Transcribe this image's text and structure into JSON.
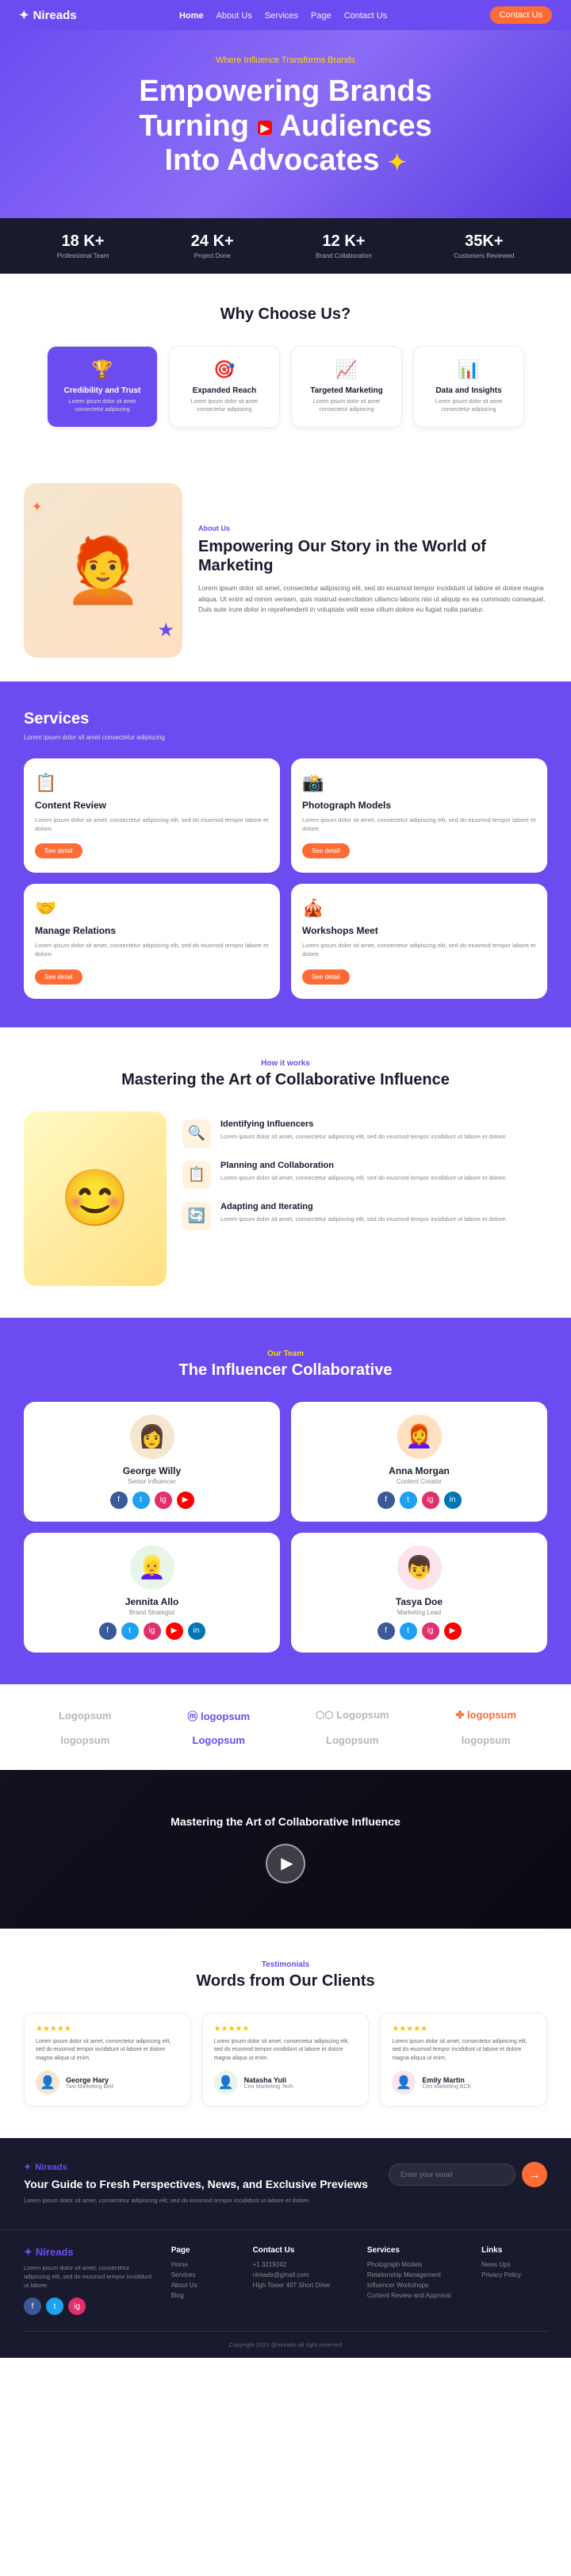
{
  "nav": {
    "logo": "Nireads",
    "links": [
      "Home",
      "About Us",
      "Services",
      "Page",
      "Contact Us"
    ],
    "active_link": "Home",
    "contact_btn": "Contact Us"
  },
  "hero": {
    "tagline": "Where Influence Transforms Brands",
    "headline_line1": "Empowering Brands",
    "headline_line2": "Turning",
    "headline_line3": "Audiences",
    "headline_line4": "Into Advocates",
    "youtube_icon": "▶",
    "star_icon": "✦"
  },
  "stats": [
    {
      "number": "18 K+",
      "label": "Professional Team"
    },
    {
      "number": "24 K+",
      "label": "Project Done"
    },
    {
      "number": "12 K+",
      "label": "Brand Collaboration"
    },
    {
      "number": "35K+",
      "label": "Customers Reviewed"
    }
  ],
  "why_choose": {
    "title": "Why Choose Us?",
    "cards": [
      {
        "icon": "🏆",
        "title": "Credibility and Trust",
        "text": "Lorem ipsum dolor sit amet consectetur adipiscing",
        "active": true
      },
      {
        "icon": "🎯",
        "title": "Expanded Reach",
        "text": "Lorem ipsum dolor sit amet consectetur adipiscing",
        "active": false
      },
      {
        "icon": "📈",
        "title": "Targeted Marketing",
        "text": "Lorem ipsum dolor sit amet consectetur adipiscing",
        "active": false
      },
      {
        "icon": "📊",
        "title": "Data and Insights",
        "text": "Lorem ipsum dolor sit amet consectetur adipiscing",
        "active": false
      }
    ]
  },
  "about": {
    "sub_label": "About Us",
    "title": "Empowering Our Story in the World of Marketing",
    "text": "Lorem ipsum dolor sit amet, consectetur adipiscing elit, sed do eiusmod tempor incididunt ut labore et dolore magna aliqua. Ut enim ad minim veniam, quis nostrud exercitation ullamco laboris nisi ut aliquip ex ea commodo consequat. Duis aute irure dolor in reprehenderit in voluptate velit esse cillum dolore eu fugiat nulla pariatur."
  },
  "services": {
    "title": "Services",
    "description": "Lorem ipsum dolor sit amet consectetur adipiscing",
    "cards": [
      {
        "icon": "📋",
        "title": "Content Review",
        "text": "Lorem ipsum dolor sit amet, consectetur adipiscing elit, sed do eiusmod tempor labore et dolore.",
        "btn": "See detail"
      },
      {
        "icon": "📸",
        "title": "Photograph Models",
        "text": "Lorem ipsum dolor sit amet, consectetur adipiscing elit, sed do eiusmod tempor labore et dolore.",
        "btn": "See detail"
      },
      {
        "icon": "🤝",
        "title": "Manage Relations",
        "text": "Lorem ipsum dolor sit amet, consectetur adipiscing elit, sed do eiusmod tempor labore et dolore.",
        "btn": "See detail"
      },
      {
        "icon": "🎪",
        "title": "Workshops Meet",
        "text": "Lorem ipsum dolor sit amet, consectetur adipiscing elit, sed do eiusmod tempor labore et dolore.",
        "btn": "See detail"
      }
    ]
  },
  "how_it_works": {
    "sub_label": "How it works",
    "title": "Mastering the Art of Collaborative Influence",
    "steps": [
      {
        "icon": "🔍",
        "title": "Identifying Influencers",
        "text": "Lorem ipsum dolor sit amet, consectetur adipiscing elit, sed do eiusmod tempor incididunt ut labore et dolore."
      },
      {
        "icon": "📋",
        "title": "Planning and Collaboration",
        "text": "Lorem ipsum dolor sit amet, consectetur adipiscing elit, sed do eiusmod tempor incididunt ut labore et dolore."
      },
      {
        "icon": "🔄",
        "title": "Adapting and Iterating",
        "text": "Lorem ipsum dolor sit amet, consectetur adipiscing elit, sed do eiusmod tempor incididunt ut labore et dolore."
      }
    ]
  },
  "team": {
    "sub_label": "Our Team",
    "title": "The Influencer Collaborative",
    "members": [
      {
        "name": "George Willy",
        "role": "Senior Influencer",
        "avatar": "👤",
        "bg": "#f5e6d0"
      },
      {
        "name": "Anna Morgan",
        "role": "Content Creator",
        "avatar": "👤",
        "bg": "#ffe0c0"
      },
      {
        "name": "Jennita Allo",
        "role": "Brand Strategist",
        "avatar": "👤",
        "bg": "#e8f5e9"
      },
      {
        "name": "Tasya Doe",
        "role": "Marketing Lead",
        "avatar": "👤",
        "bg": "#fce4ec"
      }
    ]
  },
  "logos": {
    "items": [
      {
        "text": "Logopsum",
        "type": "normal"
      },
      {
        "text": "ⓜ logopsum",
        "type": "colored"
      },
      {
        "text": "⬡⬡ Logopsum",
        "type": "normal"
      },
      {
        "text": "✤ logopsum",
        "type": "orange"
      },
      {
        "text": "logopsum",
        "type": "normal"
      },
      {
        "text": "Logopsum",
        "type": "colored"
      },
      {
        "text": "Logopsum",
        "type": "normal"
      },
      {
        "text": "logopsum",
        "type": "normal"
      }
    ]
  },
  "video": {
    "title": "Mastering the Art of Collaborative Influence",
    "play_icon": "▶"
  },
  "testimonials": {
    "sub_label": "Testimonials",
    "title": "Words from Our Clients",
    "cards": [
      {
        "stars": "★★★★★",
        "text": "Lorem ipsum dolor sit amet, consectetur adipiscing elit, sed do eiusmod tempor incididunt ut labore et dolore magna aliqua ut enim.",
        "name": "George Hary",
        "role": "Two Marketing Bird",
        "avatar": "👤",
        "bg": "#f5e6d0"
      },
      {
        "stars": "★★★★★",
        "text": "Lorem ipsum dolor sit amet, consectetur adipiscing elit, sed do eiusmod tempor incididunt ut labore et dolore magna aliqua ut enim.",
        "name": "Natasha Yuli",
        "role": "Ceo Marketing Tech",
        "avatar": "👤",
        "bg": "#e8f5e9"
      },
      {
        "stars": "★★★★★",
        "text": "Lorem ipsum dolor sit amet, consectetur adipiscing elit, sed do eiusmod tempor incididunt ut labore et dolore magna aliqua ut enim.",
        "name": "Emily Martin",
        "role": "Ceo Marketing BCK",
        "avatar": "👤",
        "bg": "#fce4ec"
      }
    ]
  },
  "newsletter": {
    "brand": "Nireads",
    "title": "Your Guide to Fresh Perspectives, News, and Exclusive Previews",
    "description": "Lorem ipsum dolor sit amet, consectetur adipiscing elit, sed do eiusmod tempor incididunt ut labore et dolore.",
    "placeholder": "Enter your email",
    "btn_icon": "→"
  },
  "footer": {
    "brand": "Nireads",
    "desc": "Lorem ipsum dolor sit amet, consectetur adipiscing elit, sed do eiusmod tempor incididunt ut labore.",
    "page_title": "Page",
    "page_links": [
      "Home",
      "Services",
      "About Us",
      "Blog"
    ],
    "contact_title": "Contact Us",
    "phone": "+1 3219242",
    "email": "nireads@gmail.com",
    "address": "High Tower 407 Short Drive",
    "services_title": "Services",
    "service_links": [
      "Photograph Models",
      "Relationship Management",
      "Influencer Workshops",
      "Content Review and Approval"
    ],
    "links_title": "Links",
    "link_items": [
      "News Ups",
      "Privacy Policy"
    ],
    "copyright": "Copyright 2023 @nireads all right reserved"
  }
}
